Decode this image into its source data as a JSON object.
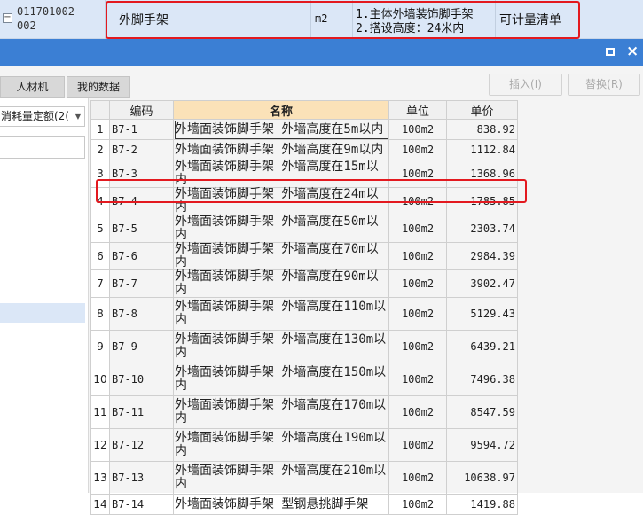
{
  "top_row": {
    "expander": "−",
    "code_line1": "011701002",
    "code_line2": "002",
    "name": "外脚手架",
    "unit": "m2",
    "feature_line1": "1.主体外墙装饰脚手架",
    "feature_line2": "2.搭设高度：24米内",
    "type": "可计量清单"
  },
  "window_controls": {
    "maximize": "maximize",
    "close": "×"
  },
  "tabs": [
    {
      "label": "人材机"
    },
    {
      "label": "我的数据"
    }
  ],
  "buttons": {
    "insert": "插入(I)",
    "replace": "替换(R)"
  },
  "left_panel": {
    "combo_value": "消耗量定额(2("
  },
  "grid": {
    "headers": {
      "code": "编码",
      "name": "名称",
      "unit": "单位",
      "price": "单价"
    },
    "rows": [
      {
        "idx": "1",
        "code": "B7-1",
        "name": "外墙面装饰脚手架 外墙高度在5m以内",
        "unit": "100m2",
        "price": "838.92"
      },
      {
        "idx": "2",
        "code": "B7-2",
        "name": "外墙面装饰脚手架 外墙高度在9m以内",
        "unit": "100m2",
        "price": "1112.84"
      },
      {
        "idx": "3",
        "code": "B7-3",
        "name": "外墙面装饰脚手架 外墙高度在15m以内",
        "unit": "100m2",
        "price": "1368.96"
      },
      {
        "idx": "4",
        "code": "B7-4",
        "name": "外墙面装饰脚手架 外墙高度在24m以内",
        "unit": "100m2",
        "price": "1785.85"
      },
      {
        "idx": "5",
        "code": "B7-5",
        "name": "外墙面装饰脚手架 外墙高度在50m以内",
        "unit": "100m2",
        "price": "2303.74"
      },
      {
        "idx": "6",
        "code": "B7-6",
        "name": "外墙面装饰脚手架 外墙高度在70m以内",
        "unit": "100m2",
        "price": "2984.39"
      },
      {
        "idx": "7",
        "code": "B7-7",
        "name": "外墙面装饰脚手架 外墙高度在90m以内",
        "unit": "100m2",
        "price": "3902.47"
      },
      {
        "idx": "8",
        "code": "B7-8",
        "name": "外墙面装饰脚手架 外墙高度在110m以内",
        "unit": "100m2",
        "price": "5129.43"
      },
      {
        "idx": "9",
        "code": "B7-9",
        "name": "外墙面装饰脚手架 外墙高度在130m以内",
        "unit": "100m2",
        "price": "6439.21"
      },
      {
        "idx": "10",
        "code": "B7-10",
        "name": "外墙面装饰脚手架 外墙高度在150m以内",
        "unit": "100m2",
        "price": "7496.38"
      },
      {
        "idx": "11",
        "code": "B7-11",
        "name": "外墙面装饰脚手架 外墙高度在170m以内",
        "unit": "100m2",
        "price": "8547.59"
      },
      {
        "idx": "12",
        "code": "B7-12",
        "name": "外墙面装饰脚手架 外墙高度在190m以内",
        "unit": "100m2",
        "price": "9594.72"
      },
      {
        "idx": "13",
        "code": "B7-13",
        "name": "外墙面装饰脚手架 外墙高度在210m以内",
        "unit": "100m2",
        "price": "10638.97"
      },
      {
        "idx": "14",
        "code": "B7-14",
        "name": "外墙面装饰脚手架 型钢悬挑脚手架",
        "unit": "100m2",
        "price": "1419.88"
      }
    ]
  },
  "colors": {
    "highlight_border": "#e3191f",
    "title_bar": "#3b7fd4",
    "name_header": "#fbe2b8",
    "row_selected": "#dbe7f7"
  }
}
